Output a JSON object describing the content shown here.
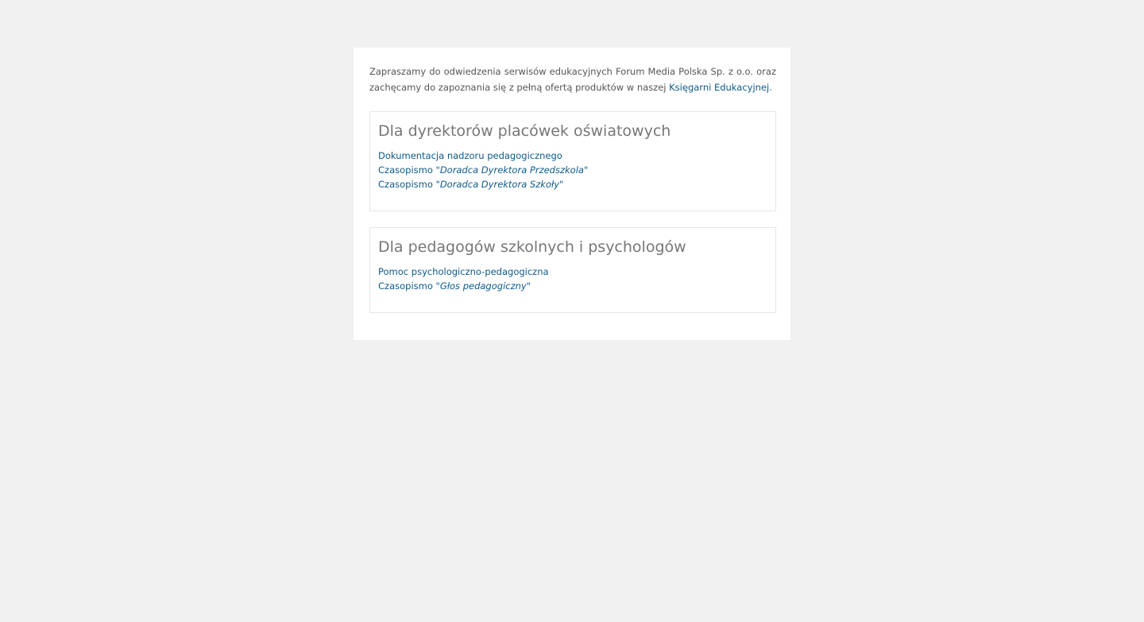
{
  "intro": {
    "text": "Zapraszamy do odwiedzenia serwisów edukacyjnych Forum Media Polska Sp. z o.o. oraz zachęcamy do zapoznania się z pełną ofertą produktów w naszej ",
    "link": "Księgarni Edukacyjnej",
    "suffix": "."
  },
  "sections": [
    {
      "title": "Dla dyrektorów placówek oświatowych",
      "links": [
        {
          "label": "Dokumentacja nadzoru pedagogicznego"
        },
        {
          "prefix": "Czasopismo \"",
          "italic": "Doradca Dyrektora Przedszkola",
          "suffix": "\""
        },
        {
          "prefix": "Czasopismo \"",
          "italic": "Doradca Dyrektora Szkoły",
          "suffix": "\""
        }
      ]
    },
    {
      "title": "Dla pedagogów szkolnych i psychologów",
      "links": [
        {
          "label": "Pomoc psychologiczno-pedagogiczna"
        },
        {
          "prefix": "Czasopismo \"",
          "italic": "Głos pedagogiczny",
          "suffix": "\""
        }
      ]
    }
  ],
  "colors": {
    "background": "#f1f1f1",
    "card": "#ffffff",
    "link": "#0d5a8a",
    "text": "#555555",
    "heading": "#777777",
    "border": "#e6e6e6"
  }
}
